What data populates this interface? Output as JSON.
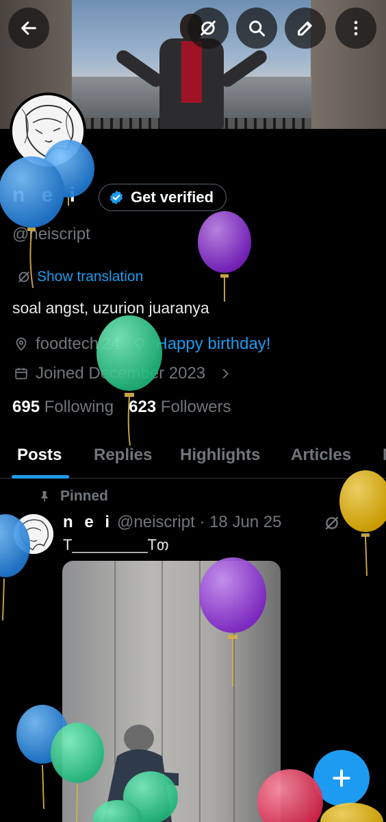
{
  "header": {
    "back_icon": "arrow-left-icon",
    "grok_icon": "grok-icon",
    "search_icon": "search-icon",
    "edit_icon": "pencil-icon",
    "more_icon": "more-vertical-icon"
  },
  "profile": {
    "display_name": "n e i",
    "get_verified_label": "Get verified",
    "handle": "@neiscript",
    "show_translation": "Show translation",
    "bio": "soal angst, uzurion juaranya",
    "location": "foodtech'24",
    "birthday": "Happy birthday!",
    "joined": "Joined December 2023",
    "following_count": "695",
    "following_label": "Following",
    "followers_count": "623",
    "followers_label": "Followers"
  },
  "tabs": [
    {
      "label": "Posts"
    },
    {
      "label": "Replies"
    },
    {
      "label": "Highlights"
    },
    {
      "label": "Articles"
    },
    {
      "label": "M"
    }
  ],
  "post": {
    "pinned_label": "Pinned",
    "author_name": "n e i",
    "meta": "@neiscript · 18 Jun 25",
    "text": "T_________Tთ"
  },
  "colors": {
    "accent": "#1d9bf0",
    "background": "#000000",
    "muted": "#71767b"
  }
}
